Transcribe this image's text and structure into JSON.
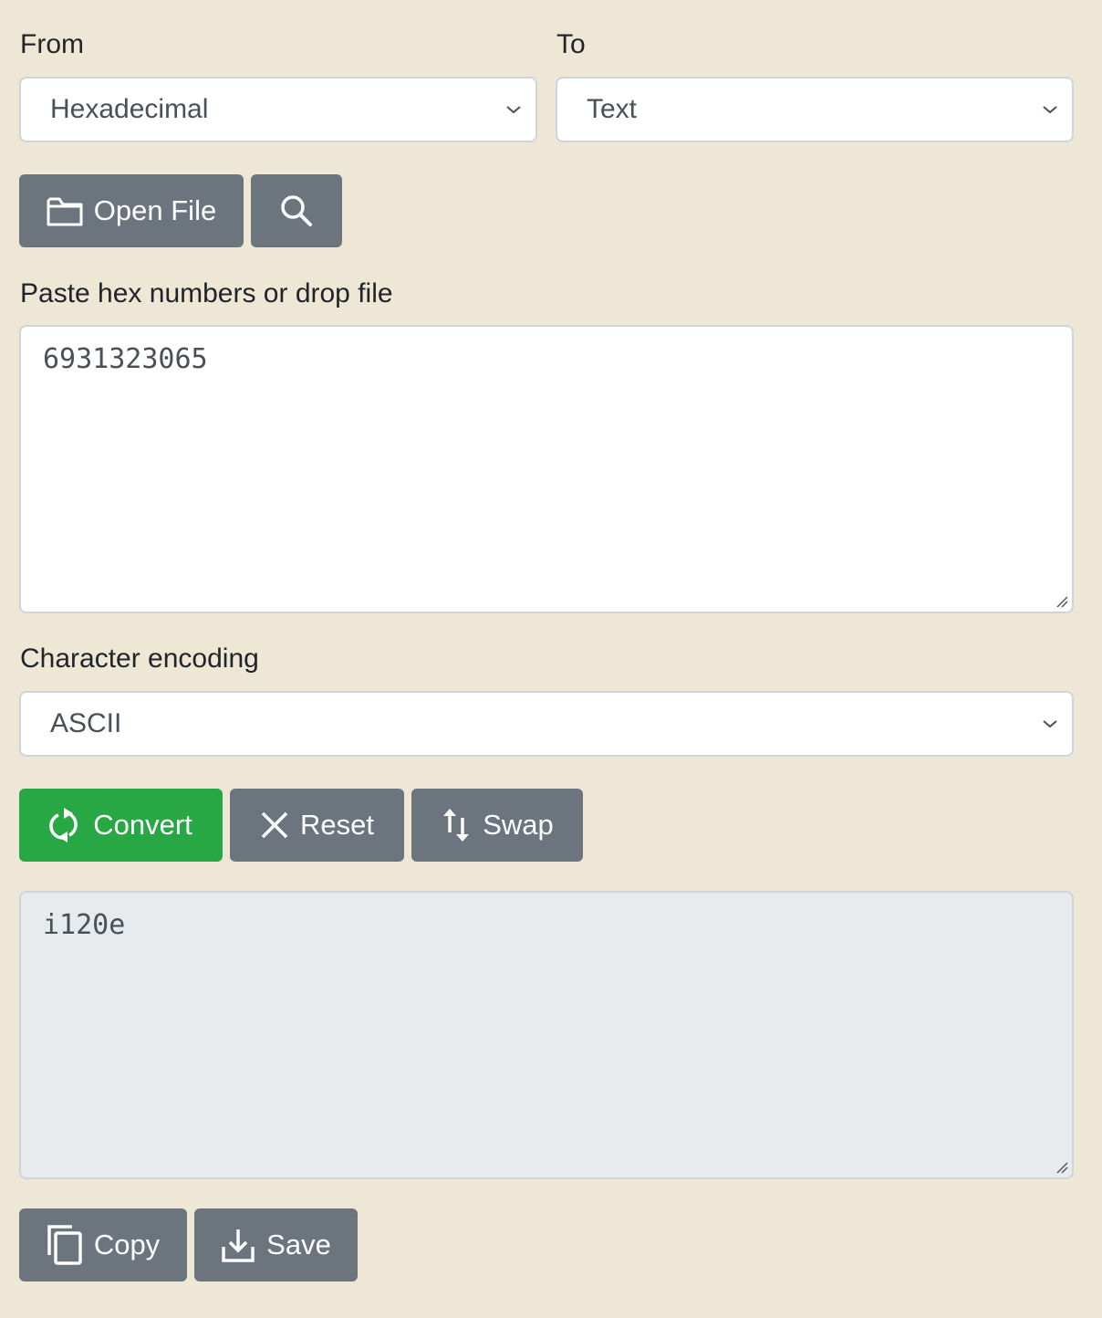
{
  "from": {
    "label": "From",
    "selected": "Hexadecimal"
  },
  "to": {
    "label": "To",
    "selected": "Text"
  },
  "toolbar_top": {
    "open_file_label": "Open File",
    "open_file_icon": "folder-icon",
    "search_icon": "search-icon"
  },
  "input": {
    "label": "Paste hex numbers or drop file",
    "value": "6931323065"
  },
  "encoding": {
    "label": "Character encoding",
    "selected": "ASCII"
  },
  "actions": {
    "convert_label": "Convert",
    "reset_label": "Reset",
    "swap_label": "Swap"
  },
  "output": {
    "value": "i120e"
  },
  "toolbar_bottom": {
    "copy_label": "Copy",
    "save_label": "Save"
  },
  "colors": {
    "background": "#eee7d6",
    "secondary": "#6c757d",
    "success": "#28a745"
  }
}
